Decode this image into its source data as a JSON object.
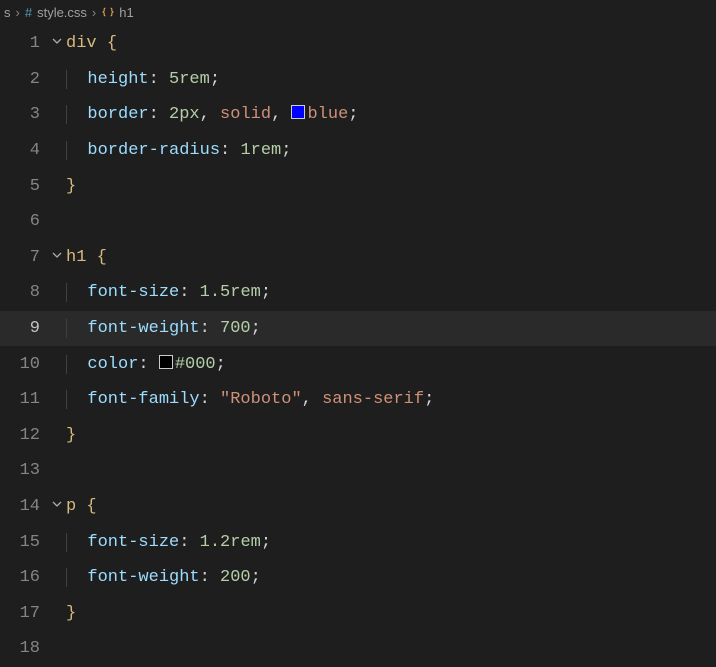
{
  "breadcrumb": {
    "partial_prefix": "s",
    "file": "style.css",
    "symbol": "h1"
  },
  "lines": [
    {
      "n": "1",
      "fold": true,
      "indent": 0,
      "segs": [
        {
          "t": "div",
          "c": "c-sel"
        },
        {
          "t": " ",
          "c": ""
        },
        {
          "t": "{",
          "c": "c-brace"
        }
      ]
    },
    {
      "n": "2",
      "fold": false,
      "indent": 1,
      "segs": [
        {
          "t": "height",
          "c": "c-prop"
        },
        {
          "t": ": ",
          "c": "c-punct"
        },
        {
          "t": "5rem",
          "c": "c-num"
        },
        {
          "t": ";",
          "c": "c-punct"
        }
      ]
    },
    {
      "n": "3",
      "fold": false,
      "indent": 1,
      "segs": [
        {
          "t": "border",
          "c": "c-prop"
        },
        {
          "t": ": ",
          "c": "c-punct"
        },
        {
          "t": "2px",
          "c": "c-num"
        },
        {
          "t": ", ",
          "c": "c-punct"
        },
        {
          "t": "solid",
          "c": "c-ident"
        },
        {
          "t": ", ",
          "c": "c-punct"
        },
        {
          "swatch": "cb-blue"
        },
        {
          "t": "blue",
          "c": "c-ident"
        },
        {
          "t": ";",
          "c": "c-punct"
        }
      ]
    },
    {
      "n": "4",
      "fold": false,
      "indent": 1,
      "segs": [
        {
          "t": "border-radius",
          "c": "c-prop"
        },
        {
          "t": ": ",
          "c": "c-punct"
        },
        {
          "t": "1rem",
          "c": "c-num"
        },
        {
          "t": ";",
          "c": "c-punct"
        }
      ]
    },
    {
      "n": "5",
      "fold": false,
      "indent": 0,
      "segs": [
        {
          "t": "}",
          "c": "c-brace"
        }
      ]
    },
    {
      "n": "6",
      "fold": false,
      "indent": 0,
      "segs": []
    },
    {
      "n": "7",
      "fold": true,
      "indent": 0,
      "segs": [
        {
          "t": "h1",
          "c": "c-sel"
        },
        {
          "t": " ",
          "c": ""
        },
        {
          "t": "{",
          "c": "c-brace"
        }
      ]
    },
    {
      "n": "8",
      "fold": false,
      "indent": 1,
      "segs": [
        {
          "t": "font-size",
          "c": "c-prop"
        },
        {
          "t": ": ",
          "c": "c-punct"
        },
        {
          "t": "1.5rem",
          "c": "c-num"
        },
        {
          "t": ";",
          "c": "c-punct"
        }
      ]
    },
    {
      "n": "9",
      "fold": false,
      "indent": 1,
      "current": true,
      "segs": [
        {
          "t": "font-weight",
          "c": "c-prop"
        },
        {
          "t": ": ",
          "c": "c-punct"
        },
        {
          "t": "700",
          "c": "c-num"
        },
        {
          "t": ";",
          "c": "c-punct"
        }
      ]
    },
    {
      "n": "10",
      "fold": false,
      "indent": 1,
      "segs": [
        {
          "t": "color",
          "c": "c-prop"
        },
        {
          "t": ": ",
          "c": "c-punct"
        },
        {
          "swatch": "cb-black"
        },
        {
          "t": "#000",
          "c": "c-num"
        },
        {
          "t": ";",
          "c": "c-punct"
        }
      ]
    },
    {
      "n": "11",
      "fold": false,
      "indent": 1,
      "segs": [
        {
          "t": "font-family",
          "c": "c-prop"
        },
        {
          "t": ": ",
          "c": "c-punct"
        },
        {
          "t": "\"Roboto\"",
          "c": "c-str"
        },
        {
          "t": ", ",
          "c": "c-punct"
        },
        {
          "t": "sans-serif",
          "c": "c-ident"
        },
        {
          "t": ";",
          "c": "c-punct"
        }
      ]
    },
    {
      "n": "12",
      "fold": false,
      "indent": 0,
      "segs": [
        {
          "t": "}",
          "c": "c-brace"
        }
      ]
    },
    {
      "n": "13",
      "fold": false,
      "indent": 0,
      "segs": []
    },
    {
      "n": "14",
      "fold": true,
      "indent": 0,
      "segs": [
        {
          "t": "p",
          "c": "c-sel"
        },
        {
          "t": " ",
          "c": ""
        },
        {
          "t": "{",
          "c": "c-brace"
        }
      ]
    },
    {
      "n": "15",
      "fold": false,
      "indent": 1,
      "segs": [
        {
          "t": "font-size",
          "c": "c-prop"
        },
        {
          "t": ": ",
          "c": "c-punct"
        },
        {
          "t": "1.2rem",
          "c": "c-num"
        },
        {
          "t": ";",
          "c": "c-punct"
        }
      ]
    },
    {
      "n": "16",
      "fold": false,
      "indent": 1,
      "segs": [
        {
          "t": "font-weight",
          "c": "c-prop"
        },
        {
          "t": ": ",
          "c": "c-punct"
        },
        {
          "t": "200",
          "c": "c-num"
        },
        {
          "t": ";",
          "c": "c-punct"
        }
      ]
    },
    {
      "n": "17",
      "fold": false,
      "indent": 0,
      "segs": [
        {
          "t": "}",
          "c": "c-brace"
        }
      ]
    },
    {
      "n": "18",
      "fold": false,
      "indent": 0,
      "segs": []
    }
  ]
}
